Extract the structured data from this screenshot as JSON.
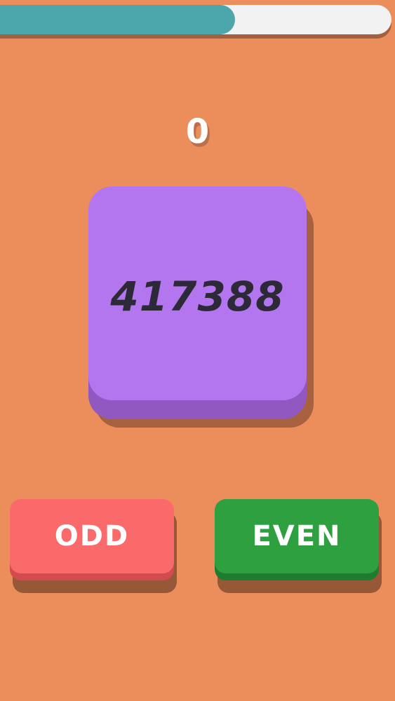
{
  "progress": {
    "fraction": 0.6,
    "fill_color": "#4ba7ab",
    "track_color": "#f2f2f2"
  },
  "score": "0",
  "card": {
    "number": "417388",
    "color": "#b476ee"
  },
  "buttons": {
    "odd_label": "ODD",
    "even_label": "EVEN",
    "odd_color": "#fa6a6a",
    "even_color": "#2fa040"
  },
  "background_color": "#ec8d5c"
}
